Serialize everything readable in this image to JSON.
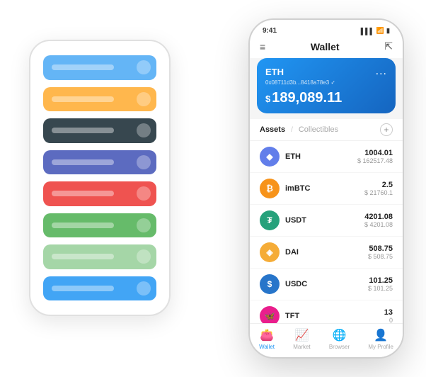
{
  "scene": {
    "bg_phone": {
      "cards": [
        {
          "color": "#64B5F6",
          "id": "blue-light"
        },
        {
          "color": "#FFB74D",
          "id": "orange"
        },
        {
          "color": "#37474F",
          "id": "dark-blue"
        },
        {
          "color": "#5C6BC0",
          "id": "purple"
        },
        {
          "color": "#EF5350",
          "id": "red"
        },
        {
          "color": "#66BB6A",
          "id": "green"
        },
        {
          "color": "#A5D6A7",
          "id": "light-green"
        },
        {
          "color": "#42A5F5",
          "id": "blue"
        }
      ]
    },
    "fg_phone": {
      "status_bar": {
        "time": "9:41",
        "signal": "▌▌▌",
        "wifi": "WiFi",
        "battery": "🔋"
      },
      "header": {
        "menu_icon": "≡",
        "title": "Wallet",
        "expand_icon": "⇱"
      },
      "eth_card": {
        "label": "ETH",
        "dots": "...",
        "address": "0x08711d3b...8418a78e3  ✓",
        "balance_symbol": "$",
        "balance": "189,089.11"
      },
      "assets": {
        "tab_active": "Assets",
        "tab_divider": "/",
        "tab_inactive": "Collectibles",
        "add_icon": "+"
      },
      "asset_list": [
        {
          "name": "ETH",
          "amount": "1004.01",
          "usd": "$ 162517.48",
          "logo_text": "◆",
          "logo_class": "eth-logo"
        },
        {
          "name": "imBTC",
          "amount": "2.5",
          "usd": "$ 21760.1",
          "logo_text": "₿",
          "logo_class": "imbtc-logo"
        },
        {
          "name": "USDT",
          "amount": "4201.08",
          "usd": "$ 4201.08",
          "logo_text": "₮",
          "logo_class": "usdt-logo"
        },
        {
          "name": "DAI",
          "amount": "508.75",
          "usd": "$ 508.75",
          "logo_text": "◈",
          "logo_class": "dai-logo"
        },
        {
          "name": "USDC",
          "amount": "101.25",
          "usd": "$ 101.25",
          "logo_text": "$",
          "logo_class": "usdc-logo"
        },
        {
          "name": "TFT",
          "amount": "13",
          "usd": "0",
          "logo_text": "🦋",
          "logo_class": "tft-logo"
        }
      ],
      "bottom_nav": [
        {
          "icon": "👛",
          "label": "Wallet",
          "active": true
        },
        {
          "icon": "📈",
          "label": "Market",
          "active": false
        },
        {
          "icon": "🌐",
          "label": "Browser",
          "active": false
        },
        {
          "icon": "👤",
          "label": "My Profile",
          "active": false
        }
      ]
    }
  }
}
